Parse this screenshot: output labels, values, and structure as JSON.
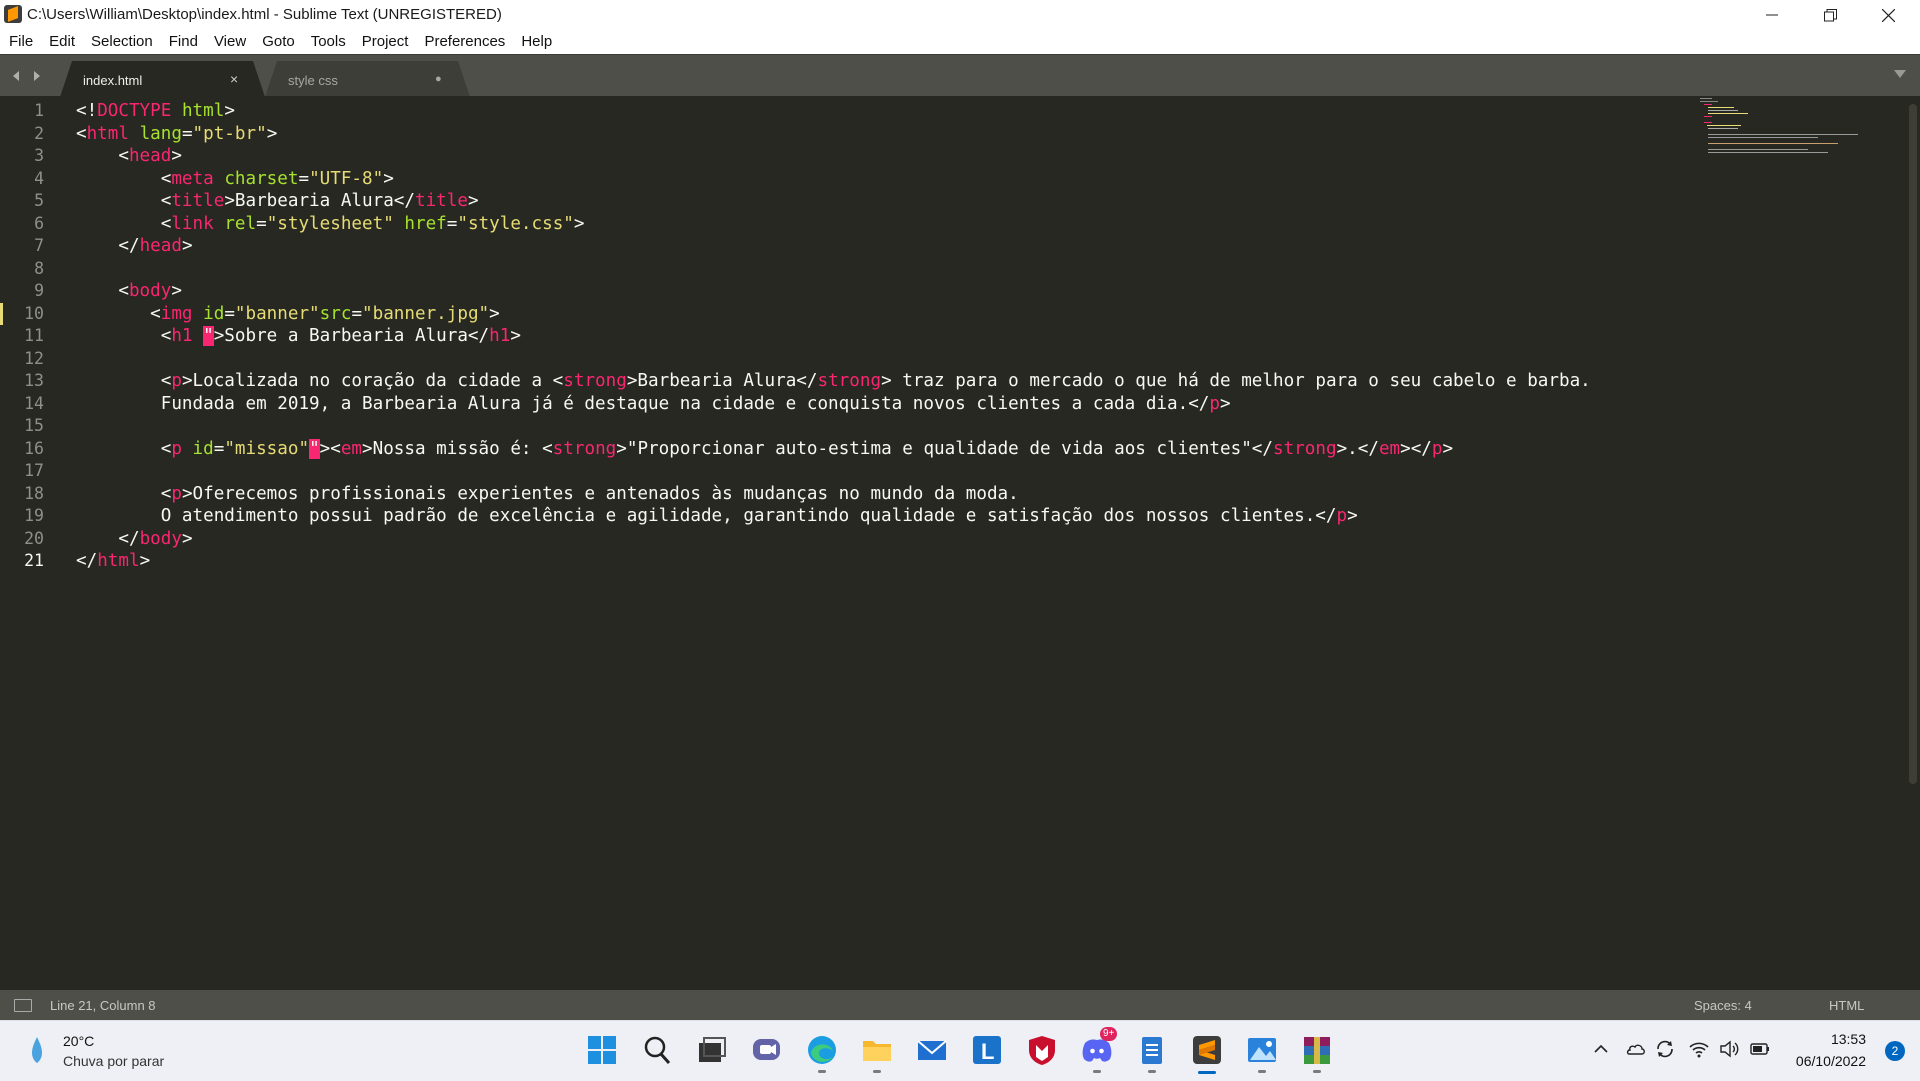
{
  "window": {
    "title": "C:\\Users\\William\\Desktop\\index.html - Sublime Text (UNREGISTERED)"
  },
  "menu": [
    "File",
    "Edit",
    "Selection",
    "Find",
    "View",
    "Goto",
    "Tools",
    "Project",
    "Preferences",
    "Help"
  ],
  "tabs": [
    {
      "label": "index.html",
      "active": true,
      "close": "×"
    },
    {
      "label": "style css",
      "active": false,
      "close": "●"
    }
  ],
  "editor": {
    "current_line": 21,
    "line_numbers": [
      "1",
      "2",
      "3",
      "4",
      "5",
      "6",
      "7",
      "8",
      "9",
      "10",
      "11",
      "12",
      "13",
      "14",
      "15",
      "16",
      "17",
      "18",
      "19",
      "20",
      "21"
    ],
    "lines": [
      [
        [
          "p",
          "<!"
        ],
        [
          "t",
          "DOCTYPE"
        ],
        [
          "p",
          " "
        ],
        [
          "a",
          "html"
        ],
        [
          "p",
          ">"
        ]
      ],
      [
        [
          "p",
          "<"
        ],
        [
          "t",
          "html"
        ],
        [
          "p",
          " "
        ],
        [
          "a",
          "lang"
        ],
        [
          "p",
          "="
        ],
        [
          "s",
          "\"pt-br\""
        ],
        [
          "p",
          ">"
        ]
      ],
      [
        [
          "p",
          "    <"
        ],
        [
          "t",
          "head"
        ],
        [
          "p",
          ">"
        ]
      ],
      [
        [
          "p",
          "        <"
        ],
        [
          "t",
          "meta"
        ],
        [
          "p",
          " "
        ],
        [
          "a",
          "charset"
        ],
        [
          "p",
          "="
        ],
        [
          "s",
          "\"UTF-8\""
        ],
        [
          "p",
          ">"
        ]
      ],
      [
        [
          "p",
          "        <"
        ],
        [
          "t",
          "title"
        ],
        [
          "p",
          ">Barbearia Alura</"
        ],
        [
          "t",
          "title"
        ],
        [
          "p",
          ">"
        ]
      ],
      [
        [
          "p",
          "        <"
        ],
        [
          "t",
          "link"
        ],
        [
          "p",
          " "
        ],
        [
          "a",
          "rel"
        ],
        [
          "p",
          "="
        ],
        [
          "s",
          "\"stylesheet\""
        ],
        [
          "p",
          " "
        ],
        [
          "a",
          "href"
        ],
        [
          "p",
          "="
        ],
        [
          "s",
          "\"style.css\""
        ],
        [
          "p",
          ">"
        ]
      ],
      [
        [
          "p",
          "    </"
        ],
        [
          "t",
          "head"
        ],
        [
          "p",
          ">"
        ]
      ],
      [],
      [
        [
          "p",
          "    <"
        ],
        [
          "t",
          "body"
        ],
        [
          "p",
          ">"
        ]
      ],
      [
        [
          "p",
          "       <"
        ],
        [
          "t",
          "img"
        ],
        [
          "p",
          " "
        ],
        [
          "a",
          "id"
        ],
        [
          "p",
          "="
        ],
        [
          "s",
          "\"banner\""
        ],
        [
          "a",
          "src"
        ],
        [
          "p",
          "="
        ],
        [
          "s",
          "\"banner.jpg\""
        ],
        [
          "p",
          ">"
        ]
      ],
      [
        [
          "p",
          "        <"
        ],
        [
          "t",
          "h1"
        ],
        [
          "p",
          " "
        ],
        [
          "err",
          "\""
        ],
        [
          "p",
          ">Sobre a Barbearia Alura</"
        ],
        [
          "t",
          "h1"
        ],
        [
          "p",
          ">"
        ]
      ],
      [],
      [
        [
          "p",
          "        <"
        ],
        [
          "t",
          "p"
        ],
        [
          "p",
          ">Localizada no coração da cidade a <"
        ],
        [
          "t",
          "strong"
        ],
        [
          "p",
          ">Barbearia Alura</"
        ],
        [
          "t",
          "strong"
        ],
        [
          "p",
          "> traz para o mercado o que há de melhor para o seu cabelo e barba."
        ]
      ],
      [
        [
          "p",
          "        Fundada em 2019, a Barbearia Alura já é destaque na cidade e conquista novos clientes a cada dia.</"
        ],
        [
          "t",
          "p"
        ],
        [
          "p",
          ">"
        ]
      ],
      [],
      [
        [
          "p",
          "        <"
        ],
        [
          "t",
          "p"
        ],
        [
          "p",
          " "
        ],
        [
          "a",
          "id"
        ],
        [
          "p",
          "="
        ],
        [
          "s",
          "\"missao\""
        ],
        [
          "err",
          "\""
        ],
        [
          "p",
          ">"
        ],
        [
          "p",
          "<"
        ],
        [
          "t",
          "em"
        ],
        [
          "p",
          ">Nossa missão é: <"
        ],
        [
          "t",
          "strong"
        ],
        [
          "p",
          ">\"Proporcionar auto-estima e qualidade de vida aos clientes\"</"
        ],
        [
          "t",
          "strong"
        ],
        [
          "p",
          ">.</"
        ],
        [
          "t",
          "em"
        ],
        [
          "p",
          "></"
        ],
        [
          "t",
          "p"
        ],
        [
          "p",
          ">"
        ]
      ],
      [],
      [
        [
          "p",
          "        <"
        ],
        [
          "t",
          "p"
        ],
        [
          "p",
          ">Oferecemos profissionais experientes e antenados às mudanças no mundo da moda."
        ]
      ],
      [
        [
          "p",
          "        O atendimento possui padrão de excelência e agilidade, garantindo qualidade e satisfação dos nossos clientes.</"
        ],
        [
          "t",
          "p"
        ],
        [
          "p",
          ">"
        ]
      ],
      [
        [
          "p",
          "    </"
        ],
        [
          "t",
          "body"
        ],
        [
          "p",
          ">"
        ]
      ],
      [
        [
          "p",
          "</"
        ],
        [
          "t",
          "html"
        ],
        [
          "p",
          ">"
        ]
      ]
    ]
  },
  "status": {
    "position": "Line 21, Column 8",
    "spaces": "Spaces: 4",
    "syntax": "HTML"
  },
  "taskbar": {
    "temperature": "20°C",
    "weather": "Chuva por parar",
    "discord_badge": "9+",
    "time": "13:53",
    "date": "06/10/2022",
    "notifications": "2"
  },
  "colors": {
    "editor_bg": "#272822",
    "tag": "#f92672",
    "attribute": "#a6e22e",
    "string": "#e6db74",
    "text": "#f8f8f2"
  }
}
